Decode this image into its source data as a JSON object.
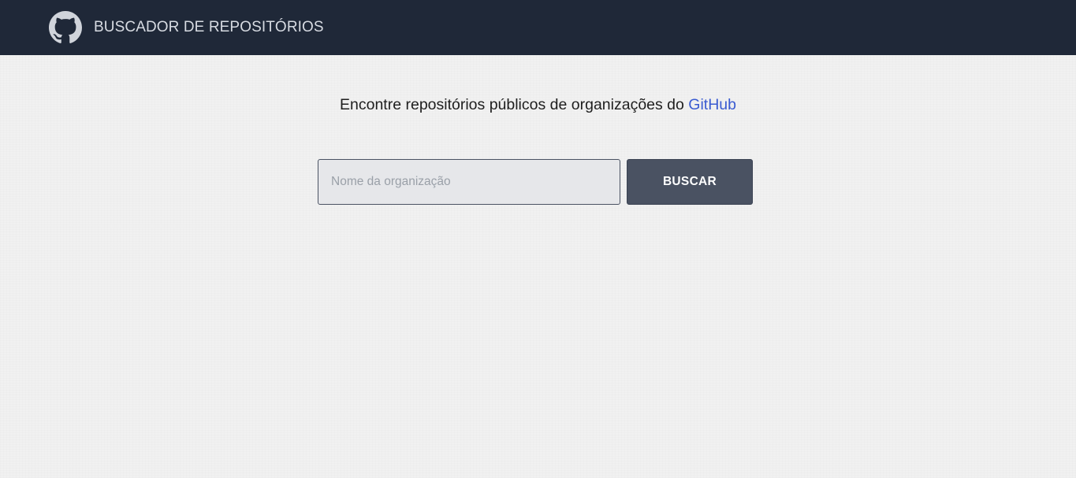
{
  "header": {
    "logo_icon": "github-logo-icon",
    "title": "BUSCADOR DE REPOSITÓRIOS",
    "background": "#1f2838"
  },
  "intro": {
    "text": "Encontre repositórios públicos de organizações do ",
    "link_label": "GitHub",
    "link_color": "#3a5bd1"
  },
  "search": {
    "value": "",
    "placeholder": "Nome da organização",
    "button_label": "BUSCAR",
    "button_color": "#4a5262"
  }
}
